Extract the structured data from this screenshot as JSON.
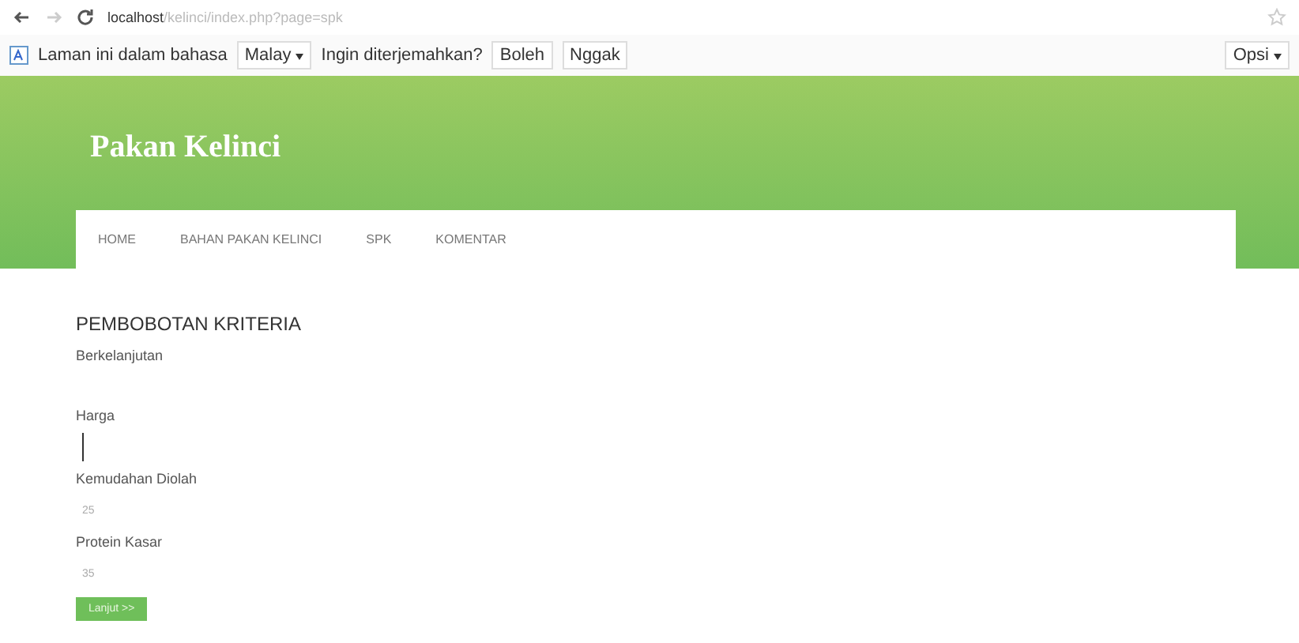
{
  "browser": {
    "url_host": "localhost",
    "url_path": "/kelinci/index.php?page=spk"
  },
  "translate_bar": {
    "message": "Laman ini dalam bahasa",
    "language": "Malay",
    "question": "Ingin diterjemahkan?",
    "buttons": [
      "Boleh",
      "Nggak"
    ],
    "options": "Opsi"
  },
  "site": {
    "title": "Pakan Kelinci"
  },
  "nav": [
    {
      "label": "HOME"
    },
    {
      "label": "BAHAN PAKAN KELINCI"
    },
    {
      "label": "SPK"
    },
    {
      "label": "KOMENTAR"
    }
  ],
  "form": {
    "heading": "PEMBOBOTAN KRITERIA",
    "subheading": "Berkelanjutan",
    "fields": [
      {
        "label": "Harga",
        "focused": true
      },
      {
        "label": "Kemudahan Diolah",
        "placeholder": "25",
        "focused": false
      },
      {
        "label": "Protein Kasar",
        "placeholder": "35",
        "focused": false
      }
    ],
    "submit": "Lanjut >>"
  }
}
